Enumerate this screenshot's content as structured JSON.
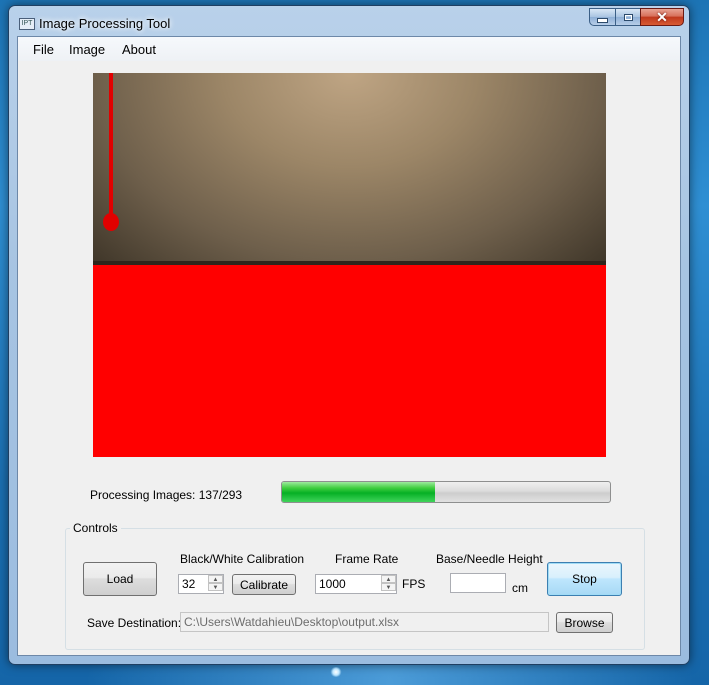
{
  "window": {
    "title": "Image Processing Tool",
    "icon_label": "IPT"
  },
  "menu": {
    "items": [
      "File",
      "Image",
      "About"
    ]
  },
  "preview": {
    "description_icon": "image-preview"
  },
  "progress": {
    "label": "Processing Images: 137/293",
    "current": 137,
    "total": 293,
    "fill_color": "#06b025"
  },
  "controls": {
    "group_title": "Controls",
    "load_label": "Load",
    "calibration": {
      "label": "Black/White Calibration",
      "value": "32",
      "button_label": "Calibrate"
    },
    "frame_rate": {
      "label": "Frame Rate",
      "value": "1000",
      "unit": "FPS"
    },
    "base_needle": {
      "label": "Base/Needle Height",
      "value": "",
      "unit": "cm"
    },
    "stop_label": "Stop",
    "save": {
      "label": "Save Destination:",
      "path": "C:\\Users\\Watdahieu\\Desktop\\output.xlsx",
      "browse_label": "Browse"
    }
  },
  "colors": {
    "mask_red": "#ff0000",
    "accent_blue": "#3c7fb1"
  }
}
